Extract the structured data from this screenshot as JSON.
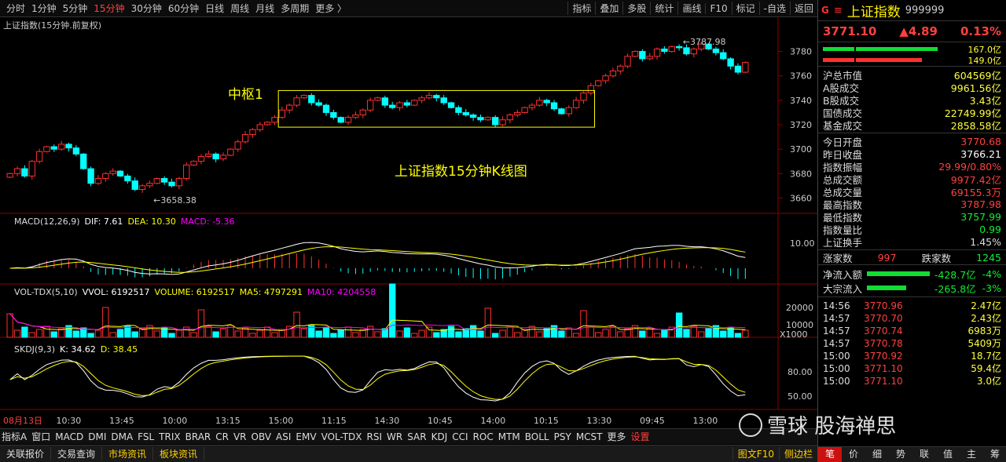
{
  "toolbar": {
    "timeframes": [
      "分时",
      "1分钟",
      "5分钟",
      "15分钟",
      "30分钟",
      "60分钟",
      "日线",
      "周线",
      "月线",
      "多周期",
      "更多 〉"
    ],
    "active_index": 3,
    "right_buttons": [
      "指标",
      "叠加",
      "多股",
      "统计",
      "画线",
      "F10",
      "标记",
      "-自选",
      "返回"
    ]
  },
  "main_panel": {
    "title": "上证指数(15分钟.前复权)",
    "y_ticks": [
      "3780",
      "3760",
      "3740",
      "3720",
      "3700",
      "3680",
      "3660"
    ],
    "high_label": "3787.98",
    "low_label": "3658.38",
    "annotation_box_label": "中枢1",
    "annotation_caption": "上证指数15分钟K线图"
  },
  "macd": {
    "name": "MACD(12,26,9)",
    "dif": "DIF: 7.61",
    "dea": "DEA: 10.30",
    "macd": "MACD: -5.36",
    "y_tick": "10.00"
  },
  "vol": {
    "name": "VOL-TDX(5,10)",
    "vvol": "VVOL: 6192517",
    "volume": "VOLUME: 6192517",
    "ma5": "MA5: 4797291",
    "ma10": "MA10: 4204558",
    "y_ticks": [
      "20000",
      "10000"
    ],
    "unit": "X1000"
  },
  "skdj": {
    "name": "SKDJ(9,3)",
    "k": "K: 34.62",
    "d": "D: 38.45",
    "y_ticks": [
      "80.00",
      "50.00"
    ]
  },
  "time_axis": [
    "08月13日",
    "10:30",
    "13:45",
    "10:00",
    "13:15",
    "15:00",
    "11:15",
    "14:30",
    "10:45",
    "14:00",
    "10:15",
    "13:30",
    "09:45",
    "13:00"
  ],
  "bottom_tabs": [
    "指标A",
    "窗口",
    "MACD",
    "DMI",
    "DMA",
    "FSL",
    "TRIX",
    "BRAR",
    "CR",
    "VR",
    "OBV",
    "ASI",
    "EMV",
    "VOL-TDX",
    "RSI",
    "WR",
    "SAR",
    "KDJ",
    "CCI",
    "ROC",
    "MTM",
    "BOLL",
    "PSY",
    "MCST",
    "更多",
    "设置"
  ],
  "status_bar": {
    "items": [
      "关联报价",
      "交易查询",
      "市场资讯",
      "板块资讯"
    ],
    "right": [
      "图文F10",
      "侧边栏"
    ]
  },
  "right_panel": {
    "badge": "G",
    "eq": "≡",
    "name": "上证指数",
    "code": "999999",
    "price": "3771.10",
    "change": "▲4.89",
    "pct": "0.13%",
    "bars": {
      "up": "167.0亿",
      "down": "149.0亿"
    },
    "stats1": [
      {
        "k": "沪总市值",
        "v": "604569亿"
      },
      {
        "k": "A股成交",
        "v": "9961.56亿"
      },
      {
        "k": "B股成交",
        "v": "3.43亿"
      },
      {
        "k": "国债成交",
        "v": "22749.99亿"
      },
      {
        "k": "基金成交",
        "v": "2858.58亿"
      }
    ],
    "stats2": [
      {
        "k": "今日开盘",
        "v": "3770.68"
      },
      {
        "k": "昨日收盘",
        "v": "3766.21"
      },
      {
        "k": "指数振幅",
        "v": "29.99/0.80%"
      },
      {
        "k": "总成交额",
        "v": "9977.42亿"
      },
      {
        "k": "总成交量",
        "v": "69155.3万"
      },
      {
        "k": "最高指数",
        "v": "3787.98"
      },
      {
        "k": "最低指数",
        "v": "3757.99"
      },
      {
        "k": "指数量比",
        "v": "0.99"
      },
      {
        "k": "上证换手",
        "v": "1.45%"
      }
    ],
    "breadth": {
      "up_label": "涨家数",
      "up": "997",
      "down_label": "跌家数",
      "down": "1245"
    },
    "flow": [
      {
        "k": "净流入额",
        "v": "-428.7亿",
        "p": "-4%"
      },
      {
        "k": "大宗流入",
        "v": "-265.8亿",
        "p": "-3%"
      }
    ],
    "ticks": [
      {
        "t": "14:56",
        "p": "3770.96",
        "v": "2.47亿"
      },
      {
        "t": "14:57",
        "p": "3770.70",
        "v": "2.43亿"
      },
      {
        "t": "14:57",
        "p": "3770.74",
        "v": "6983万"
      },
      {
        "t": "14:57",
        "p": "3770.78",
        "v": "5409万"
      },
      {
        "t": "15:00",
        "p": "3770.92",
        "v": "18.7亿"
      },
      {
        "t": "15:00",
        "p": "3771.10",
        "v": "59.4亿"
      },
      {
        "t": "15:00",
        "p": "3771.10",
        "v": "3.0亿"
      }
    ],
    "tabs": [
      "笔",
      "价",
      "细",
      "势",
      "联",
      "值",
      "主",
      "筹"
    ]
  },
  "watermark": "雪球 股海禅思",
  "colors": {
    "up": "#ff3030",
    "down": "#00ffff",
    "dif": "#ffffff",
    "dea": "#ffff00",
    "ma10": "#ff00ff",
    "box": "#ffff00"
  },
  "chart_data": {
    "type": "candlestick",
    "ylim": [
      3650,
      3790
    ],
    "closes": [
      3680,
      3684,
      3678,
      3690,
      3698,
      3702,
      3700,
      3704,
      3701,
      3696,
      3684,
      3672,
      3676,
      3680,
      3682,
      3678,
      3674,
      3667,
      3670,
      3672,
      3676,
      3673,
      3670,
      3676,
      3687,
      3690,
      3694,
      3696,
      3692,
      3695,
      3700,
      3706,
      3712,
      3716,
      3720,
      3722,
      3726,
      3732,
      3736,
      3742,
      3744,
      3738,
      3736,
      3730,
      3726,
      3722,
      3726,
      3728,
      3732,
      3740,
      3742,
      3736,
      3734,
      3738,
      3736,
      3740,
      3742,
      3744,
      3742,
      3738,
      3734,
      3730,
      3728,
      3726,
      3724,
      3726,
      3720,
      3724,
      3728,
      3730,
      3734,
      3736,
      3740,
      3738,
      3733,
      3729,
      3734,
      3740,
      3746,
      3752,
      3756,
      3760,
      3764,
      3768,
      3776,
      3780,
      3774,
      3776,
      3782,
      3780,
      3784,
      3783,
      3778,
      3782,
      3786,
      3782,
      3779,
      3774,
      3768,
      3763,
      3771
    ]
  }
}
